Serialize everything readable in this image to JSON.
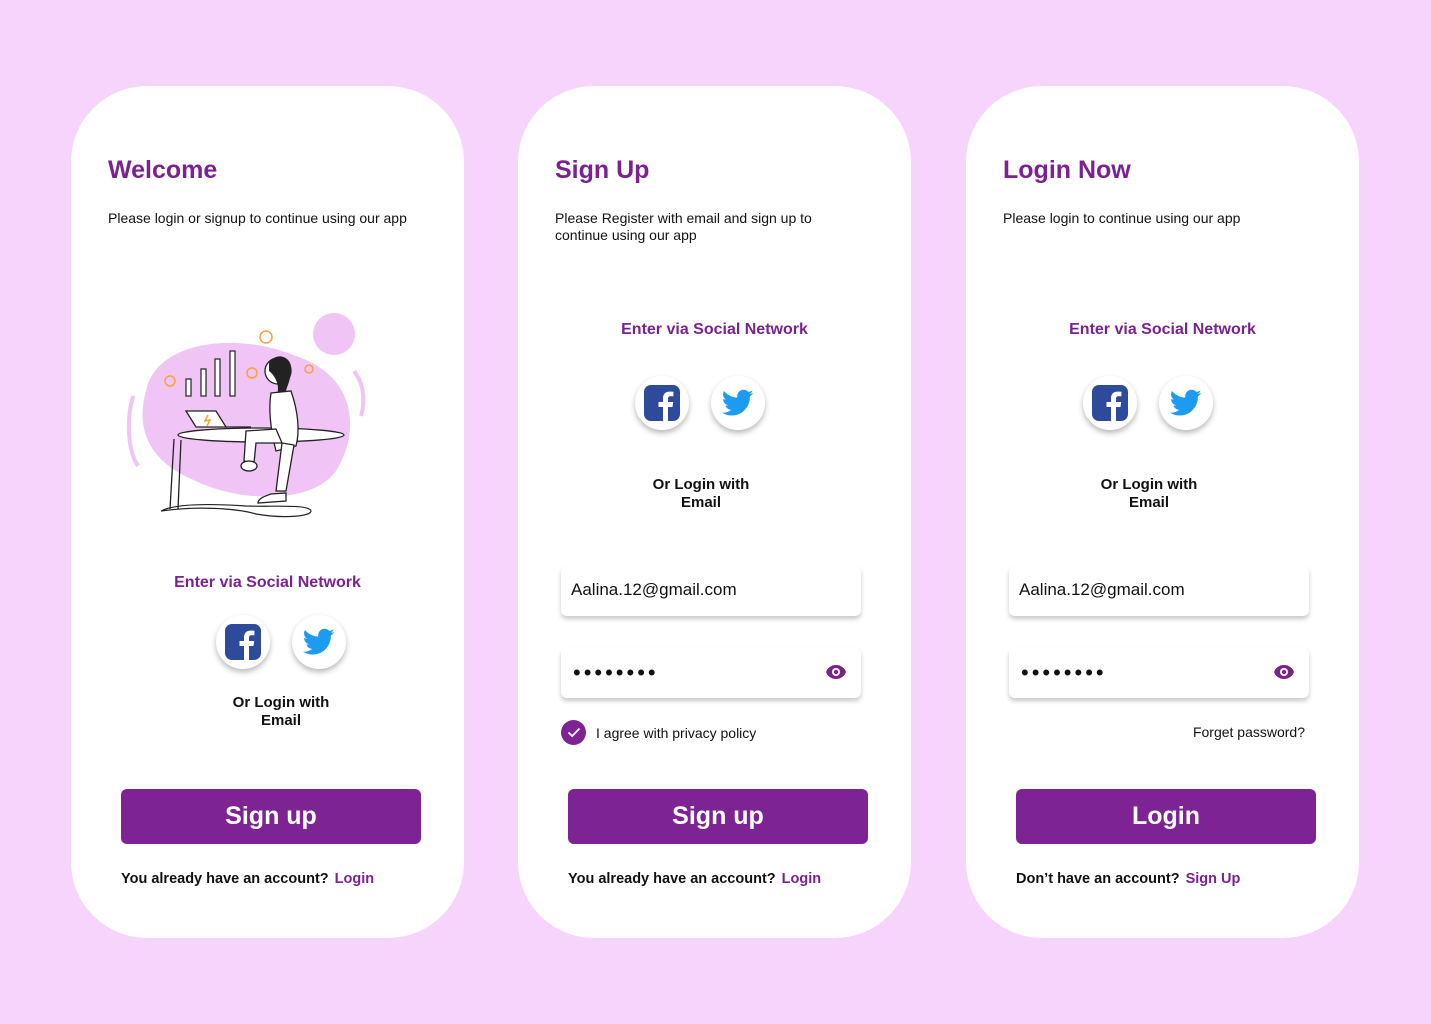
{
  "colors": {
    "background": "#f6d4fb",
    "accent": "#7b2191",
    "button": "#7d2393",
    "facebook": "#2d4b9a",
    "twitter": "#1d9bf0"
  },
  "icons": {
    "facebook": "facebook-icon",
    "twitter": "twitter-icon",
    "eye": "eye-icon",
    "check": "check-icon"
  },
  "welcome": {
    "title": "Welcome",
    "subtitle": "Please login or signup to continue using our app",
    "social_heading": "Enter via Social Network",
    "or_line1": "Or Login with",
    "or_line2": "Email",
    "button": "Sign up",
    "footer_text": "You already have an account?",
    "footer_link": "Login"
  },
  "signup": {
    "title": "Sign Up",
    "subtitle": "Please Register with email and sign up to continue using our app",
    "social_heading": "Enter via Social Network",
    "or_line1": "Or Login with",
    "or_line2": "Email",
    "email": "Aalina.12@gmail.com",
    "password_mask": "••••••••",
    "agree": "I agree with privacy policy",
    "agree_checked": true,
    "button": "Sign up",
    "footer_text": "You already have an account?",
    "footer_link": "Login"
  },
  "login": {
    "title": "Login Now",
    "subtitle": "Please login to continue using our app",
    "social_heading": "Enter via Social Network",
    "or_line1": "Or Login with",
    "or_line2": "Email",
    "email": "Aalina.12@gmail.com",
    "password_mask": "••••••••",
    "forget": "Forget password?",
    "button": "Login",
    "footer_text": "Don’t have an account?",
    "footer_link": "Sign Up"
  }
}
